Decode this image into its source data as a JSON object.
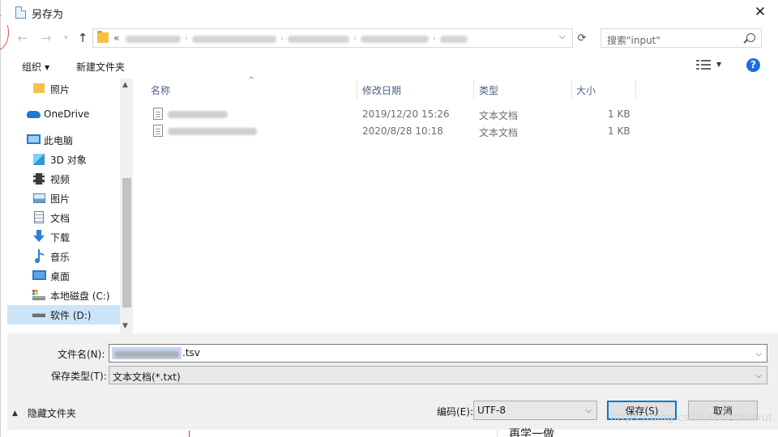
{
  "window": {
    "title": "另存为",
    "close_glyph": "✕"
  },
  "navigation": {
    "back_glyph": "←",
    "forward_glyph": "→",
    "recent_glyph": "▾",
    "up_glyph": "↑",
    "address_overflow": "«",
    "breadcrumbs_obscured": 6,
    "address_dropdown_glyph": "⌵",
    "refresh_glyph": "⟳"
  },
  "search": {
    "placeholder": "搜索\"input\""
  },
  "toolbar": {
    "organize_label": "组织",
    "organize_caret": "▼",
    "new_folder_label": "新建文件夹",
    "view_dropdown_glyph": "▼",
    "help_glyph": "?"
  },
  "sidebar": {
    "items": [
      {
        "label": "照片",
        "icon": "folder-icon"
      },
      {
        "label": "OneDrive",
        "icon": "onedrive-icon"
      },
      {
        "label": "此电脑",
        "icon": "computer-icon"
      },
      {
        "label": "3D 对象",
        "icon": "cube-3d-icon"
      },
      {
        "label": "视频",
        "icon": "video-icon"
      },
      {
        "label": "图片",
        "icon": "pictures-icon"
      },
      {
        "label": "文档",
        "icon": "documents-icon"
      },
      {
        "label": "下载",
        "icon": "download-icon"
      },
      {
        "label": "音乐",
        "icon": "music-icon"
      },
      {
        "label": "桌面",
        "icon": "desktop-icon"
      },
      {
        "label": "本地磁盘 (C:)",
        "icon": "disk-c-icon"
      },
      {
        "label": "软件 (D:)",
        "icon": "disk-d-icon",
        "selected": true
      }
    ],
    "scroll_up_glyph": "▲",
    "scroll_down_glyph": "▼"
  },
  "file_list": {
    "sort_indicator": "^",
    "columns": [
      "名称",
      "修改日期",
      "类型",
      "大小"
    ],
    "rows": [
      {
        "name": "[blurred]",
        "modified": "2019/12/20 15:26",
        "type": "文本文档",
        "size": "1 KB"
      },
      {
        "name": "[blurred]",
        "modified": "2020/8/28 10:18",
        "type": "文本文档",
        "size": "1 KB"
      }
    ]
  },
  "form": {
    "filename_label": "文件名(N):",
    "filename_suffix": ".tsv",
    "filetype_label": "保存类型(T):",
    "filetype_value": "文本文档(*.txt)",
    "encoding_label": "编码(E):",
    "encoding_value": "UTF-8",
    "dropdown_glyph": "⌵"
  },
  "footer": {
    "hide_folders_label": "隐藏文件夹",
    "hide_caret": "▲",
    "save_label": "保存(S)",
    "cancel_label": "取消"
  },
  "background": {
    "watermark": "https://blog.csdn.net/zbrwhut",
    "partial_text": "再学一做"
  },
  "colors": {
    "selection": "#cce4f7",
    "accent": "#0078d7",
    "help": "#1e6fd6",
    "header_text": "#4d6185",
    "panel": "#f0f0f0"
  }
}
